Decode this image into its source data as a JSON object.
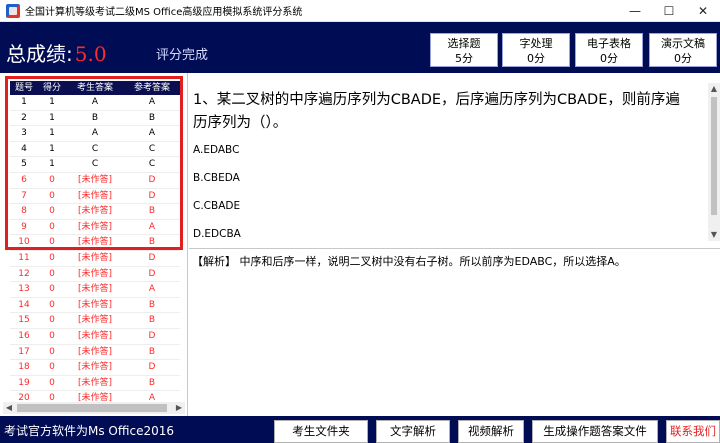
{
  "window": {
    "title": "全国计算机等级考试二级MS Office高级应用模拟系统评分系统",
    "minimize": "—",
    "maximize": "☐",
    "close": "✕"
  },
  "header": {
    "score_label": "总成绩:",
    "score_value": "5.0",
    "status": "评分完成",
    "categories": [
      {
        "label": "选择题",
        "score": "5分"
      },
      {
        "label": "字处理",
        "score": "0分"
      },
      {
        "label": "电子表格",
        "score": "0分"
      },
      {
        "label": "演示文稿",
        "score": "0分"
      }
    ]
  },
  "results": {
    "columns": [
      "题号",
      "得分",
      "考生答案",
      "参考答案"
    ],
    "rows": [
      {
        "no": "1",
        "score": "1",
        "answer": "A",
        "ref": "A",
        "ok": true
      },
      {
        "no": "2",
        "score": "1",
        "answer": "B",
        "ref": "B",
        "ok": true
      },
      {
        "no": "3",
        "score": "1",
        "answer": "A",
        "ref": "A",
        "ok": true
      },
      {
        "no": "4",
        "score": "1",
        "answer": "C",
        "ref": "C",
        "ok": true
      },
      {
        "no": "5",
        "score": "1",
        "answer": "C",
        "ref": "C",
        "ok": true
      },
      {
        "no": "6",
        "score": "0",
        "answer": "[未作答]",
        "ref": "D",
        "ok": false
      },
      {
        "no": "7",
        "score": "0",
        "answer": "[未作答]",
        "ref": "D",
        "ok": false
      },
      {
        "no": "8",
        "score": "0",
        "answer": "[未作答]",
        "ref": "B",
        "ok": false
      },
      {
        "no": "9",
        "score": "0",
        "answer": "[未作答]",
        "ref": "A",
        "ok": false
      },
      {
        "no": "10",
        "score": "0",
        "answer": "[未作答]",
        "ref": "B",
        "ok": false
      },
      {
        "no": "11",
        "score": "0",
        "answer": "[未作答]",
        "ref": "D",
        "ok": false
      },
      {
        "no": "12",
        "score": "0",
        "answer": "[未作答]",
        "ref": "D",
        "ok": false
      },
      {
        "no": "13",
        "score": "0",
        "answer": "[未作答]",
        "ref": "A",
        "ok": false
      },
      {
        "no": "14",
        "score": "0",
        "answer": "[未作答]",
        "ref": "B",
        "ok": false
      },
      {
        "no": "15",
        "score": "0",
        "answer": "[未作答]",
        "ref": "B",
        "ok": false
      },
      {
        "no": "16",
        "score": "0",
        "answer": "[未作答]",
        "ref": "D",
        "ok": false
      },
      {
        "no": "17",
        "score": "0",
        "answer": "[未作答]",
        "ref": "B",
        "ok": false
      },
      {
        "no": "18",
        "score": "0",
        "answer": "[未作答]",
        "ref": "D",
        "ok": false
      },
      {
        "no": "19",
        "score": "0",
        "answer": "[未作答]",
        "ref": "B",
        "ok": false
      },
      {
        "no": "20",
        "score": "0",
        "answer": "[未作答]",
        "ref": "A",
        "ok": false
      }
    ]
  },
  "question": {
    "text": "1、某二叉树的中序遍历序列为CBADE，后序遍历序列为CBADE，则前序遍历序列为（）。",
    "options": [
      "A.EDABC",
      "B.CBEDA",
      "C.CBADE",
      "D.EDCBA"
    ]
  },
  "analysis": {
    "text": "【解析】 中序和后序一样，说明二叉树中没有右子树。所以前序为EDABC，所以选择A。"
  },
  "footer": {
    "software": "考试官方软件为Ms Office2016",
    "buttons": [
      "考生文件夹",
      "文字解析",
      "视频解析",
      "生成操作题答案文件",
      "联系我们"
    ]
  },
  "colors": {
    "header_bg": "#000d54",
    "score_red": "#ff2a2a",
    "highlight_red": "#e02020"
  }
}
